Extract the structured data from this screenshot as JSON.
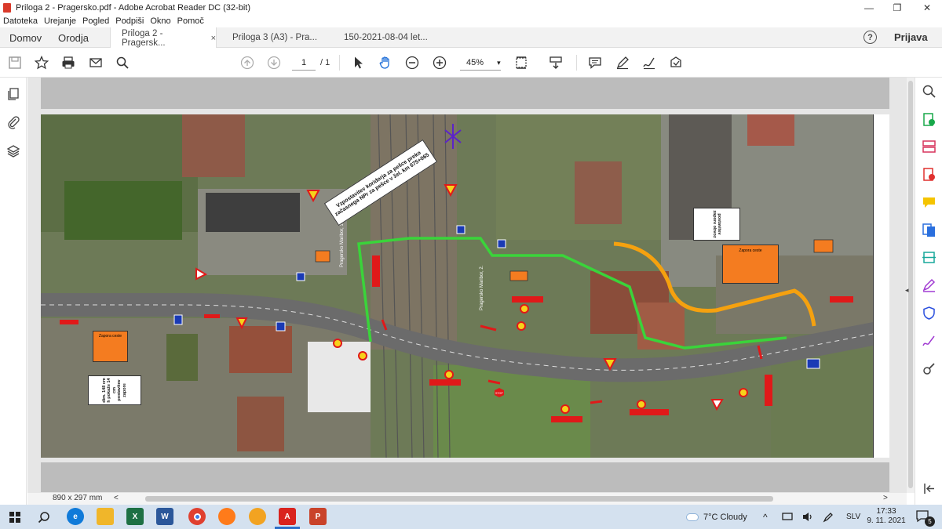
{
  "window": {
    "title": "Priloga 2 - Pragersko.pdf - Adobe Acrobat Reader DC (32-bit)",
    "controls": {
      "minimize": "—",
      "maximize": "❐",
      "close": "✕"
    }
  },
  "menu": [
    "Datoteka",
    "Urejanje",
    "Pogled",
    "Podpiši",
    "Okno",
    "Pomoč"
  ],
  "nav_tabs": {
    "home": "Domov",
    "tools": "Orodja"
  },
  "doc_tabs": [
    {
      "label": "Priloga 2 - Pragersk...",
      "close": "×"
    },
    {
      "label": "Priloga 3 (A3) - Pra..."
    },
    {
      "label": "150-2021-08-04 let..."
    }
  ],
  "help": "?",
  "signin": "Prijava",
  "toolbar": {
    "page_current": "1",
    "page_total": "/ 1",
    "zoom": "45%",
    "zoom_caret": "▾",
    "icons": [
      "save-icon",
      "star-icon",
      "print-icon",
      "email-icon",
      "search-icon",
      "page-up-icon",
      "page-down-icon",
      "select-arrow-icon",
      "hand-icon",
      "zoom-out-icon",
      "zoom-in-icon",
      "page-fit-icon",
      "scroll-mode-icon",
      "comment-icon",
      "highlight-pen-icon",
      "sign-icon",
      "share-icon"
    ]
  },
  "map_annotations": {
    "corridor_note": "Vzpostavitev koridorja za pešce preko začasnega NPr za pešce v žel. km 675+065",
    "track1_label": "Pragersko Maribor, 1.",
    "track2_label": "Pragersko Maribor, 2.",
    "left_sign": "Zapora ceste",
    "left_note": "dim. 148 cm h pokaže 14 cm postavitev zapore",
    "right_sign": "Zapora ceste",
    "right_note": "postavitev zapore obvoz",
    "stop_text": "STOP"
  },
  "status": {
    "page_size": "890 x 297 mm",
    "scroll_left": "<",
    "scroll_right": ">"
  },
  "side_collapse": {
    "left": "◂",
    "right": "◂"
  },
  "taskbar": {
    "weather": "7°C  Cloudy",
    "language": "SLV",
    "time": "17:33",
    "date": "9. 11. 2021",
    "notifications": "5",
    "apps": [
      "start-icon",
      "search-icon",
      "edge-icon",
      "explorer-icon",
      "excel-icon",
      "word-icon",
      "chrome-icon",
      "firefox-icon",
      "photos-icon",
      "acrobat-icon",
      "powerpoint-icon"
    ]
  },
  "colors": {
    "green_path": "#3ad43a",
    "orange_path": "#f5a10f",
    "road": "#6b6b6b",
    "sign_orange": "#f47c20"
  }
}
